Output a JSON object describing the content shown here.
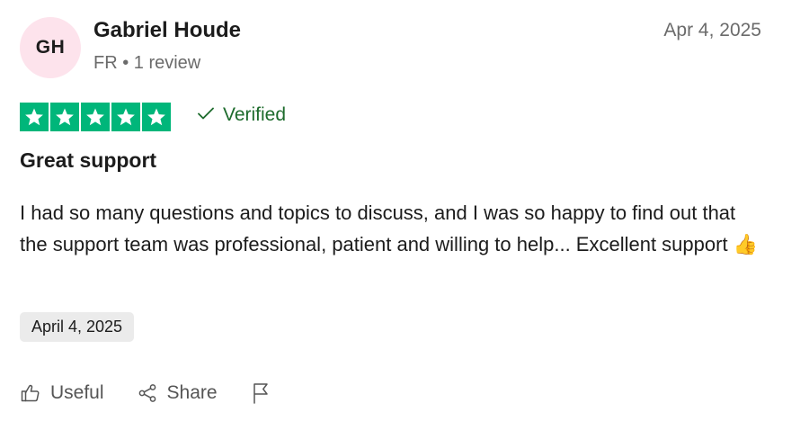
{
  "reviewer": {
    "initials": "GH",
    "name": "Gabriel Houde",
    "meta": "FR • 1 review"
  },
  "review_date": "Apr 4, 2025",
  "rating": {
    "stars": 5,
    "max": 5,
    "color": "#00b67a"
  },
  "verified": {
    "label": "Verified",
    "icon": "checkmark-icon",
    "color": "#1d6b2c"
  },
  "review": {
    "title": "Great support",
    "body": "I had so many questions and topics to discuss, and I was so happy to find out that the support team was professional, patient and willing to help... Excellent support 👍",
    "experience_date": "April 4, 2025"
  },
  "actions": {
    "useful_label": "Useful",
    "useful_icon": "thumbs-up-icon",
    "share_label": "Share",
    "share_icon": "share-icon",
    "flag_icon": "flag-icon"
  }
}
